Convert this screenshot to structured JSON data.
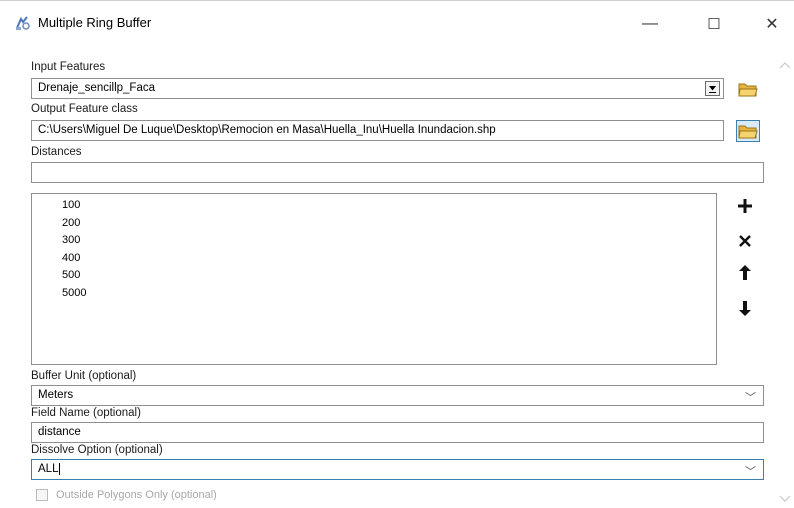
{
  "window": {
    "title": "Multiple Ring Buffer",
    "icon": "tool-icon"
  },
  "controls": {
    "minimize": "—",
    "maximize": "☐",
    "close": "✕"
  },
  "input_features": {
    "label": "Input Features",
    "value": "Drenaje_sencillp_Faca"
  },
  "output_feature_class": {
    "label": "Output Feature class",
    "value": "C:\\Users\\Miguel De Luque\\Desktop\\Remocion en Masa\\Huella_Inu\\Huella Inundacion.shp"
  },
  "distances": {
    "label": "Distances",
    "input_value": "",
    "items": [
      "100",
      "200",
      "300",
      "400",
      "500",
      "5000"
    ]
  },
  "list_buttons": {
    "add": "+",
    "remove": "×",
    "up": "↑",
    "down": "↓"
  },
  "buffer_unit": {
    "label": "Buffer Unit (optional)",
    "value": "Meters"
  },
  "field_name": {
    "label": "Field Name (optional)",
    "value": "distance"
  },
  "dissolve_option": {
    "label": "Dissolve Option (optional)",
    "value": "ALL"
  },
  "outside_polygons": {
    "label": "Outside Polygons Only (optional)",
    "checked": false
  },
  "colors": {
    "folder": "#e3b440",
    "focus_border": "#3c7fb1",
    "disabled_text": "#a8a8a8"
  }
}
